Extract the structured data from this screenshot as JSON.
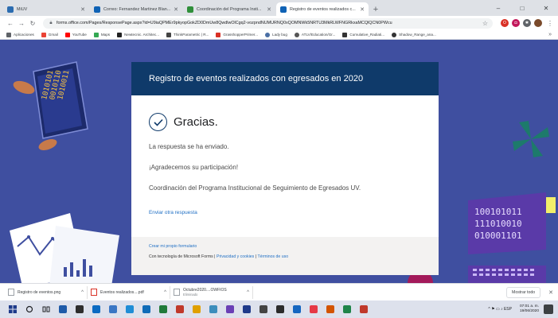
{
  "browser": {
    "tabs": [
      {
        "title": "MiUV",
        "favicon_color": "#2b6cb0",
        "active": false
      },
      {
        "title": "Correo: Fernandez Martinez Blan...",
        "favicon_color": "#0f62b5",
        "active": false
      },
      {
        "title": "Coordinación del Programa Insti...",
        "favicon_color": "#2f8f3a",
        "active": false
      },
      {
        "title": "Registro de eventos realizados c...",
        "favicon_color": "#0f62b5",
        "active": true
      }
    ],
    "new_tab_label": "+",
    "window_controls": {
      "minimize": "–",
      "maximize": "□",
      "close": "✕"
    },
    "address": "forms.office.com/Pages/ResponsePage.aspx?id=U9iaQPMEr9pkyopGokZD0DmUw8QwdlwOlCgq2-vozpndNUMURNQ0xQOMNWk5NRTU3MkRLWFNGRkxaMCQlQCN0PWcu",
    "bookmarks": [
      {
        "label": "Aplicaciones",
        "color": "#5f6368"
      },
      {
        "label": "Gmail",
        "color": "#ea4335"
      },
      {
        "label": "YouTube",
        "color": "#ff0000"
      },
      {
        "label": "Maps",
        "color": "#34a853"
      },
      {
        "label": "Newtecnic. Architec...",
        "color": "#222222"
      },
      {
        "label": "ThinkParametric | R...",
        "color": "#444444"
      },
      {
        "label": "GrasshopperPrimer...",
        "color": "#d93025"
      },
      {
        "label": "Lady bug",
        "color": "#4a6fa5"
      },
      {
        "label": "ATLV/Education/Gr...",
        "color": "#555555"
      },
      {
        "label": "Cumulative_Radiati...",
        "color": "#333333"
      },
      {
        "label": "Shadow_Range_ana...",
        "color": "#333333"
      }
    ],
    "bookmarks_more": "»"
  },
  "form": {
    "title": "Registro de eventos realizados con egresados en 2020",
    "thanks": "Gracias.",
    "messages": [
      "La respuesta se ha enviado.",
      "¡Agradecemos su participación!",
      "Coordinación del Programa Institucional de Seguimiento de Egresados UV."
    ],
    "another_response": "Enviar otra respuesta",
    "footer": {
      "create_link": "Crear mi propio formulario",
      "powered_prefix": "Con tecnología de Microsoft Forms |",
      "privacy": "Privacidad y cookies",
      "separator": "|",
      "terms": "Términos de uso"
    },
    "header_color": "#0f3a6a",
    "background_color": "#3f4fa0"
  },
  "decor": {
    "binary_left": [
      "1010101",
      "0010110",
      "1010011"
    ],
    "binary_right": [
      "100101011",
      "111010010",
      "010001101"
    ]
  },
  "downloads": {
    "items": [
      {
        "name": "Registro de eventos.png",
        "sub": "",
        "type": "image"
      },
      {
        "name": "Eventos realizados....pdf",
        "sub": "",
        "type": "pdf"
      },
      {
        "name": "Octubre2020....OWFIOS",
        "sub": "Eliminado",
        "type": "file"
      }
    ],
    "show_all": "Mostrar todo",
    "close": "✕"
  },
  "taskbar": {
    "app_colors": [
      "#1e5aa8",
      "#2d2d2d",
      "#0a6ac2",
      "#3a76c4",
      "#1f8dd6",
      "#0f6bb8",
      "#1f7a3a",
      "#c0392b",
      "#e0a000",
      "#3c8dbc",
      "#6a3fb5",
      "#1f3a8a",
      "#444444",
      "#2b2b2b",
      "#1565c0",
      "#e63946",
      "#d35400",
      "#1e8449",
      "#c0392b"
    ],
    "tray_symbols": "^ ⚑ ▭ ♪ ESP",
    "time": "07:01 a. m.",
    "date": "19/06/2020"
  }
}
